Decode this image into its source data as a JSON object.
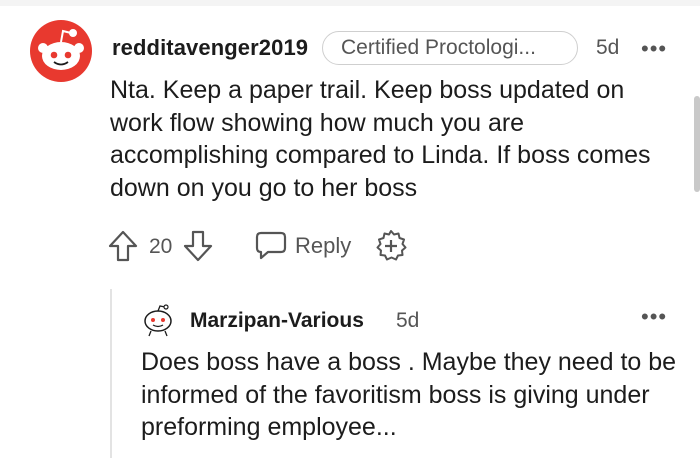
{
  "comment": {
    "author": "redditavenger2019",
    "flair": "Certified Proctologi...",
    "time": "5d",
    "more": "•••",
    "body": "Nta. Keep a paper trail. Keep boss updated on work flow showing how much you are accomplishing compared to Linda. If boss comes down on you go to her boss",
    "score": "20",
    "reply_label": "Reply"
  },
  "reply": {
    "author": "Marzipan-Various",
    "time": "5d",
    "more": "•••",
    "body": "Does boss have a boss . Maybe they need to be informed of the favoritism boss is giving under preforming employee..."
  },
  "icons": {
    "avatar1": "snoo-avatar-icon",
    "avatar2": "snoo-avatar-icon",
    "upvote": "upvote-arrow-icon",
    "downvote": "downvote-arrow-icon",
    "reply": "speech-bubble-icon",
    "award": "award-plus-icon"
  },
  "colors": {
    "avatar_red": "#e8392f",
    "text": "#1c1c1c",
    "muted": "#555555",
    "thread_line": "#e3e3e3"
  }
}
